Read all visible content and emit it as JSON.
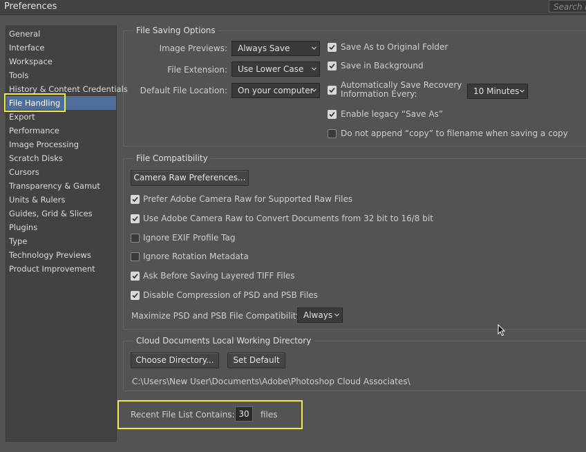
{
  "window": {
    "title": "Preferences",
    "search_placeholder": "Search P"
  },
  "sidebar": {
    "selected": "File Handling",
    "items": [
      "General",
      "Interface",
      "Workspace",
      "Tools",
      "History & Content Credentials",
      "File Handling",
      "Export",
      "Performance",
      "Image Processing",
      "Scratch Disks",
      "Cursors",
      "Transparency & Gamut",
      "Units & Rulers",
      "Guides, Grid & Slices",
      "Plugins",
      "Type",
      "Technology Previews",
      "Product Improvement"
    ]
  },
  "file_saving": {
    "title": "File Saving Options",
    "image_previews_label": "Image Previews:",
    "image_previews_value": "Always Save",
    "file_extension_label": "File Extension:",
    "file_extension_value": "Use Lower Case",
    "default_location_label": "Default File Location:",
    "default_location_value": "On your computer",
    "save_as_original_folder": {
      "label": "Save As to Original Folder",
      "checked": true
    },
    "save_in_background": {
      "label": "Save in Background",
      "checked": true
    },
    "auto_save_recovery": {
      "label_line1": "Automatically Save Recovery",
      "label_line2": "Information Every:",
      "checked": true
    },
    "auto_save_interval": "10 Minutes",
    "enable_legacy_save_as": {
      "label": "Enable legacy “Save As”",
      "checked": true
    },
    "do_not_append_copy": {
      "label": "Do not append “copy” to filename when saving a copy",
      "checked": false
    }
  },
  "file_compat": {
    "title": "File Compatibility",
    "camera_raw_button": "Camera Raw Preferences...",
    "options": [
      {
        "label": "Prefer Adobe Camera Raw for Supported Raw Files",
        "checked": true
      },
      {
        "label": "Use Adobe Camera Raw to Convert Documents from 32 bit to 16/8 bit",
        "checked": true
      },
      {
        "label": "Ignore EXIF Profile Tag",
        "checked": false
      },
      {
        "label": "Ignore Rotation Metadata",
        "checked": false
      },
      {
        "label": "Ask Before Saving Layered TIFF Files",
        "checked": true
      },
      {
        "label": "Disable Compression of PSD and PSB Files",
        "checked": true
      }
    ],
    "maximize_label": "Maximize PSD and PSB File Compatibility:",
    "maximize_value": "Always"
  },
  "cloud_docs": {
    "title": "Cloud Documents Local Working Directory",
    "choose_button": "Choose Directory...",
    "default_button": "Set Default",
    "path": "C:\\Users\\New User\\Documents\\Adobe\\Photoshop Cloud Associates\\"
  },
  "recent_files": {
    "label": "Recent File List Contains:",
    "value": "30",
    "unit": "files"
  },
  "colors": {
    "highlight": "#f2ea4a",
    "selected": "#4f6e99",
    "background": "#535353"
  }
}
